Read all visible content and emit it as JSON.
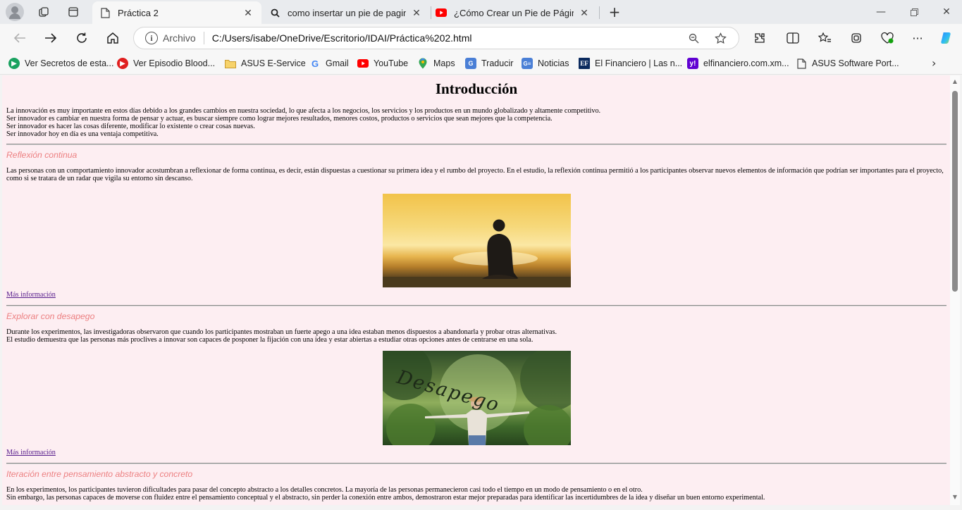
{
  "tabs": [
    {
      "title": "Práctica 2",
      "active": true
    },
    {
      "title": "como insertar un pie de pagina en",
      "active": false
    },
    {
      "title": "¿Cómo Crear un Pie de Página Efe",
      "active": false
    }
  ],
  "toolbar": {
    "scheme": "Archivo",
    "url": "C:/Users/isabe/OneDrive/Escritorio/IDAI/Práctica%202.html"
  },
  "bookmarks": [
    {
      "label": "Ver Secretos de esta...",
      "icon": "play-circle-icon",
      "color": "#1aa260"
    },
    {
      "label": "Ver Episodio Blood...",
      "icon": "play-circle-icon",
      "color": "#e01f1f"
    },
    {
      "label": "ASUS E-Service",
      "icon": "folder-icon",
      "color": "#e8b53a"
    },
    {
      "label": "Gmail",
      "icon": "google-icon",
      "color": "#4285f4"
    },
    {
      "label": "YouTube",
      "icon": "youtube-icon",
      "color": "#ff0000"
    },
    {
      "label": "Maps",
      "icon": "maps-pin-icon",
      "color": "#34a853"
    },
    {
      "label": "Traducir",
      "icon": "translate-icon",
      "color": "#4a7fd6"
    },
    {
      "label": "Noticias",
      "icon": "news-icon",
      "color": "#4a7fd6"
    },
    {
      "label": "El Financiero | Las n...",
      "icon": "ef-icon",
      "color": "#0b2a5e"
    },
    {
      "label": "elfinanciero.com.xm...",
      "icon": "yahoo-icon",
      "color": "#6001d2"
    },
    {
      "label": "ASUS Software Port...",
      "icon": "page-icon",
      "color": "#555555"
    }
  ],
  "page": {
    "title": "Introducción",
    "intro": [
      "La innovación es muy importante en estos días debido a los grandes cambios en nuestra sociedad, lo que afecta a los negocios, los servicios y los productos en un mundo globalizado y altamente competitivo.",
      "Ser innovador es cambiar en nuestra forma de pensar y actuar, es buscar siempre como lograr mejores resultados, menores costos, productos o servicios que sean mejores que la competencia.",
      "Ser innovador es hacer las cosas diferente, modificar lo existente o crear cosas nuevas.",
      "Ser innovador hoy en día es una ventaja competitiva."
    ],
    "sections": [
      {
        "heading": "Reflexión continua",
        "body": [
          "Las personas con un comportamiento innovador acostumbran a reflexionar de forma continua, es decir, están dispuestas a cuestionar su primera idea y el rumbo del proyecto. En el estudio, la reflexión continua permitió a los participantes observar nuevos elementos de información que podrían ser importantes para el proyecto, como si se tratara de un radar que vigila su entorno sin descanso."
        ],
        "link": "Más información"
      },
      {
        "heading": "Explorar con desapego",
        "body": [
          "Durante los experimentos, las investigadoras observaron que cuando los participantes mostraban un fuerte apego a una idea estaban menos dispuestos a abandonarla y probar otras alternativas.",
          "El estudio demuestra que las personas más proclives a innovar son capaces de posponer la fijación con una idea y estar abiertas a estudiar otras opciones antes de centrarse en una sola."
        ],
        "image_text": "Desapego",
        "link": "Más información"
      },
      {
        "heading": "Iteración entre pensamiento abstracto y concreto",
        "body": [
          "En los experimentos, los participantes tuvieron dificultades para pasar del concepto abstracto a los detalles concretos. La mayoría de las personas permanecieron casi todo el tiempo en un modo de pensamiento o en el otro.",
          "Sin embargo, las personas capaces de moverse con fluidez entre el pensamiento conceptual y el abstracto, sin perder la conexión entre ambos, demostraron estar mejor preparadas para identificar las incertidumbres de la idea y diseñar un buen entorno experimental."
        ]
      }
    ]
  },
  "colors": {
    "page_background": "#fdeef2",
    "heading_accent": "#ec7f80",
    "visited_link": "#551a8b"
  }
}
